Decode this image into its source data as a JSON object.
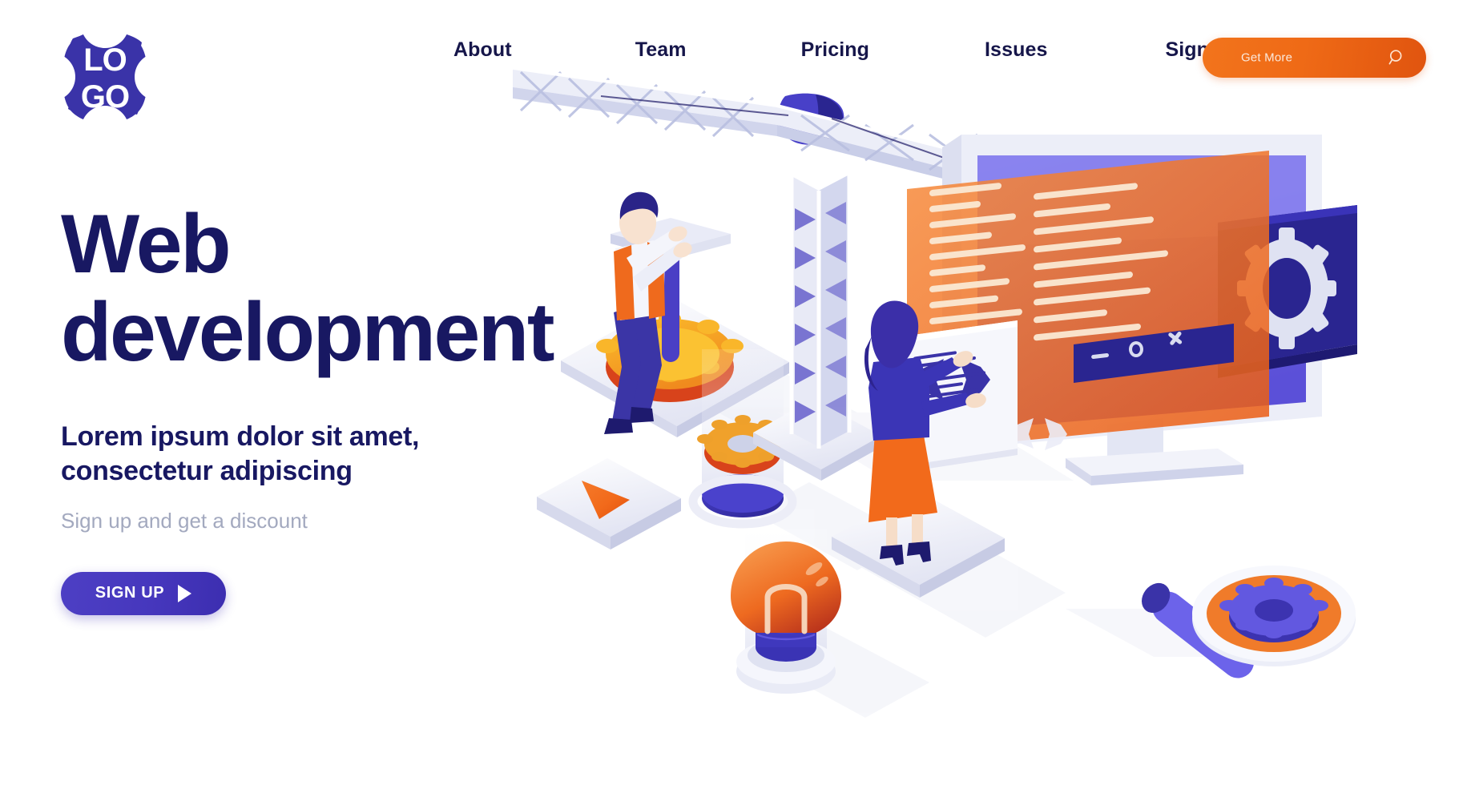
{
  "brand": {
    "logo_text_top": "LO",
    "logo_text_bottom": "GO",
    "logo_color": "#3a33a8"
  },
  "nav": {
    "items": [
      {
        "label": "About"
      },
      {
        "label": "Team"
      },
      {
        "label": "Pricing"
      },
      {
        "label": "Issues"
      },
      {
        "label": "Sign In"
      }
    ],
    "cta": {
      "label": "Get More",
      "icon": "search-icon",
      "bg_start": "#f2741c",
      "bg_end": "#e0540f",
      "text_color": "#fbe9dc"
    }
  },
  "hero": {
    "title_line1": "Web",
    "title_line2": "development",
    "title_color": "#181862",
    "subtitle_line1": "Lorem ipsum dolor sit amet,",
    "subtitle_line2": "consectetur adipiscing",
    "note": "Sign up and get a discount",
    "note_color": "#a3a9bf",
    "cta": {
      "label": "SIGN UP",
      "icon": "play-triangle-icon",
      "bg_start": "#4d3fc4",
      "bg_end": "#3c2eb0",
      "text_color": "#ffffff"
    }
  },
  "illustration": {
    "name": "isometric-web-development-scene",
    "palette": {
      "orange": "#f26a1b",
      "orange_light": "#f7a23a",
      "orange_deep": "#d9401a",
      "yellow": "#f8b318",
      "purple": "#4c3fc9",
      "purple_deep": "#2a2580",
      "indigo_dark": "#1e1b6e",
      "lavender": "#8b87e8",
      "white_panel": "#f3f4fb",
      "shadow": "#e9ebf4"
    },
    "objects": [
      {
        "name": "construction-crane",
        "description": "white lattice tower crane with horizontal jib"
      },
      {
        "name": "desktop-monitor",
        "description": "isometric monitor with purple screen"
      },
      {
        "name": "code-window-orange",
        "description": "translucent orange code editor panel with code lines"
      },
      {
        "name": "window-controls",
        "labels": [
          "—",
          "O",
          "X"
        ]
      },
      {
        "name": "settings-card",
        "description": "dark blue card with white gear icon"
      },
      {
        "name": "code-tag-card",
        "description": "white card with </> code tag and text lines"
      },
      {
        "name": "worker-male",
        "description": "man in orange vest turning a crank on a yellow gear"
      },
      {
        "name": "gear-platform",
        "description": "yellow-orange gear on white isometric platform"
      },
      {
        "name": "designer-female",
        "description": "woman with purple top and orange skirt gesturing at the screen"
      },
      {
        "name": "gear-cylinder",
        "description": "orange gear inside glass cylinder on blue base"
      },
      {
        "name": "lightbulb-cylinder",
        "description": "orange lightbulb inside glass cylinder on white base"
      },
      {
        "name": "play-tile",
        "description": "white tile with orange triangle play symbol"
      },
      {
        "name": "magnifier-gear",
        "description": "magnifying glass with purple handle and purple gear in orange lens"
      }
    ]
  }
}
